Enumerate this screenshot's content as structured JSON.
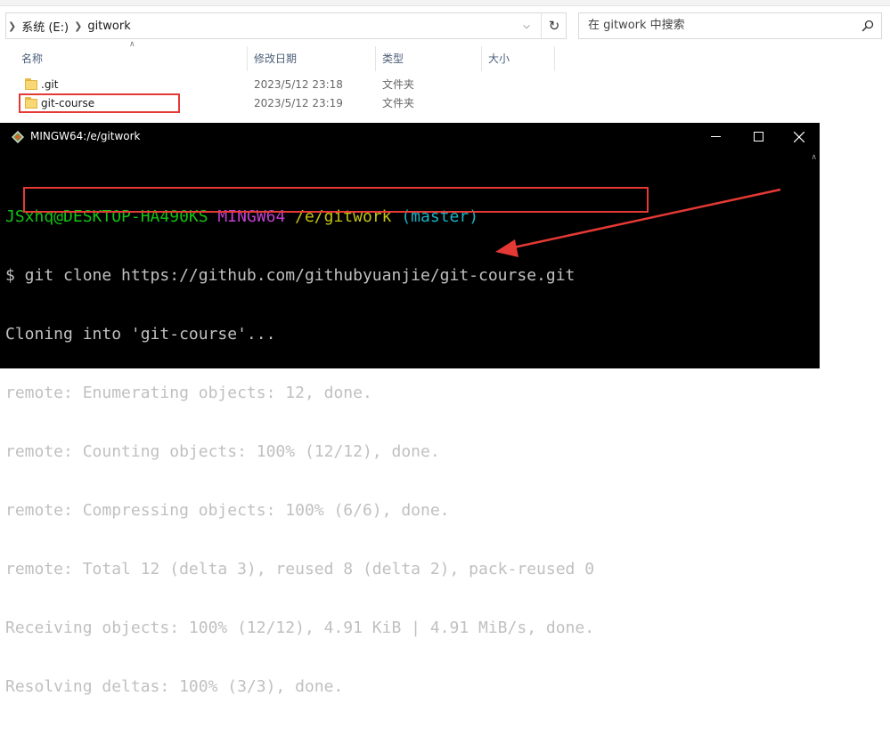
{
  "explorer": {
    "address": {
      "segments": [
        "系统 (E:)",
        "gitwork"
      ]
    },
    "search": {
      "placeholder": "在 gitwork 中搜索"
    },
    "columns": [
      "名称",
      "修改日期",
      "类型",
      "大小"
    ],
    "files": [
      {
        "name": ".git",
        "date": "2023/5/12 23:18",
        "type": "文件夹"
      },
      {
        "name": "git-course",
        "date": "2023/5/12 23:19",
        "type": "文件夹"
      }
    ]
  },
  "terminal": {
    "title": "MINGW64:/e/gitwork",
    "prompt": {
      "user": "JSxhq@DESKTOP-HA490KS",
      "system": "MINGW64",
      "path": "/e/gitwork",
      "branch": "(master)"
    },
    "command_line": "$ git clone https://github.com/githubyuanjie/git-course.git",
    "output": [
      "Cloning into 'git-course'...",
      "remote: Enumerating objects: 12, done.",
      "remote: Counting objects: 100% (12/12), done.",
      "remote: Compressing objects: 100% (6/6), done.",
      "remote: Total 12 (delta 3), reused 8 (delta 2), pack-reused 0",
      "Receiving objects: 100% (12/12), 4.91 KiB | 4.91 MiB/s, done.",
      "Resolving deltas: 100% (3/3), done."
    ]
  },
  "annotations": {
    "highlight_color": "#e53935"
  }
}
